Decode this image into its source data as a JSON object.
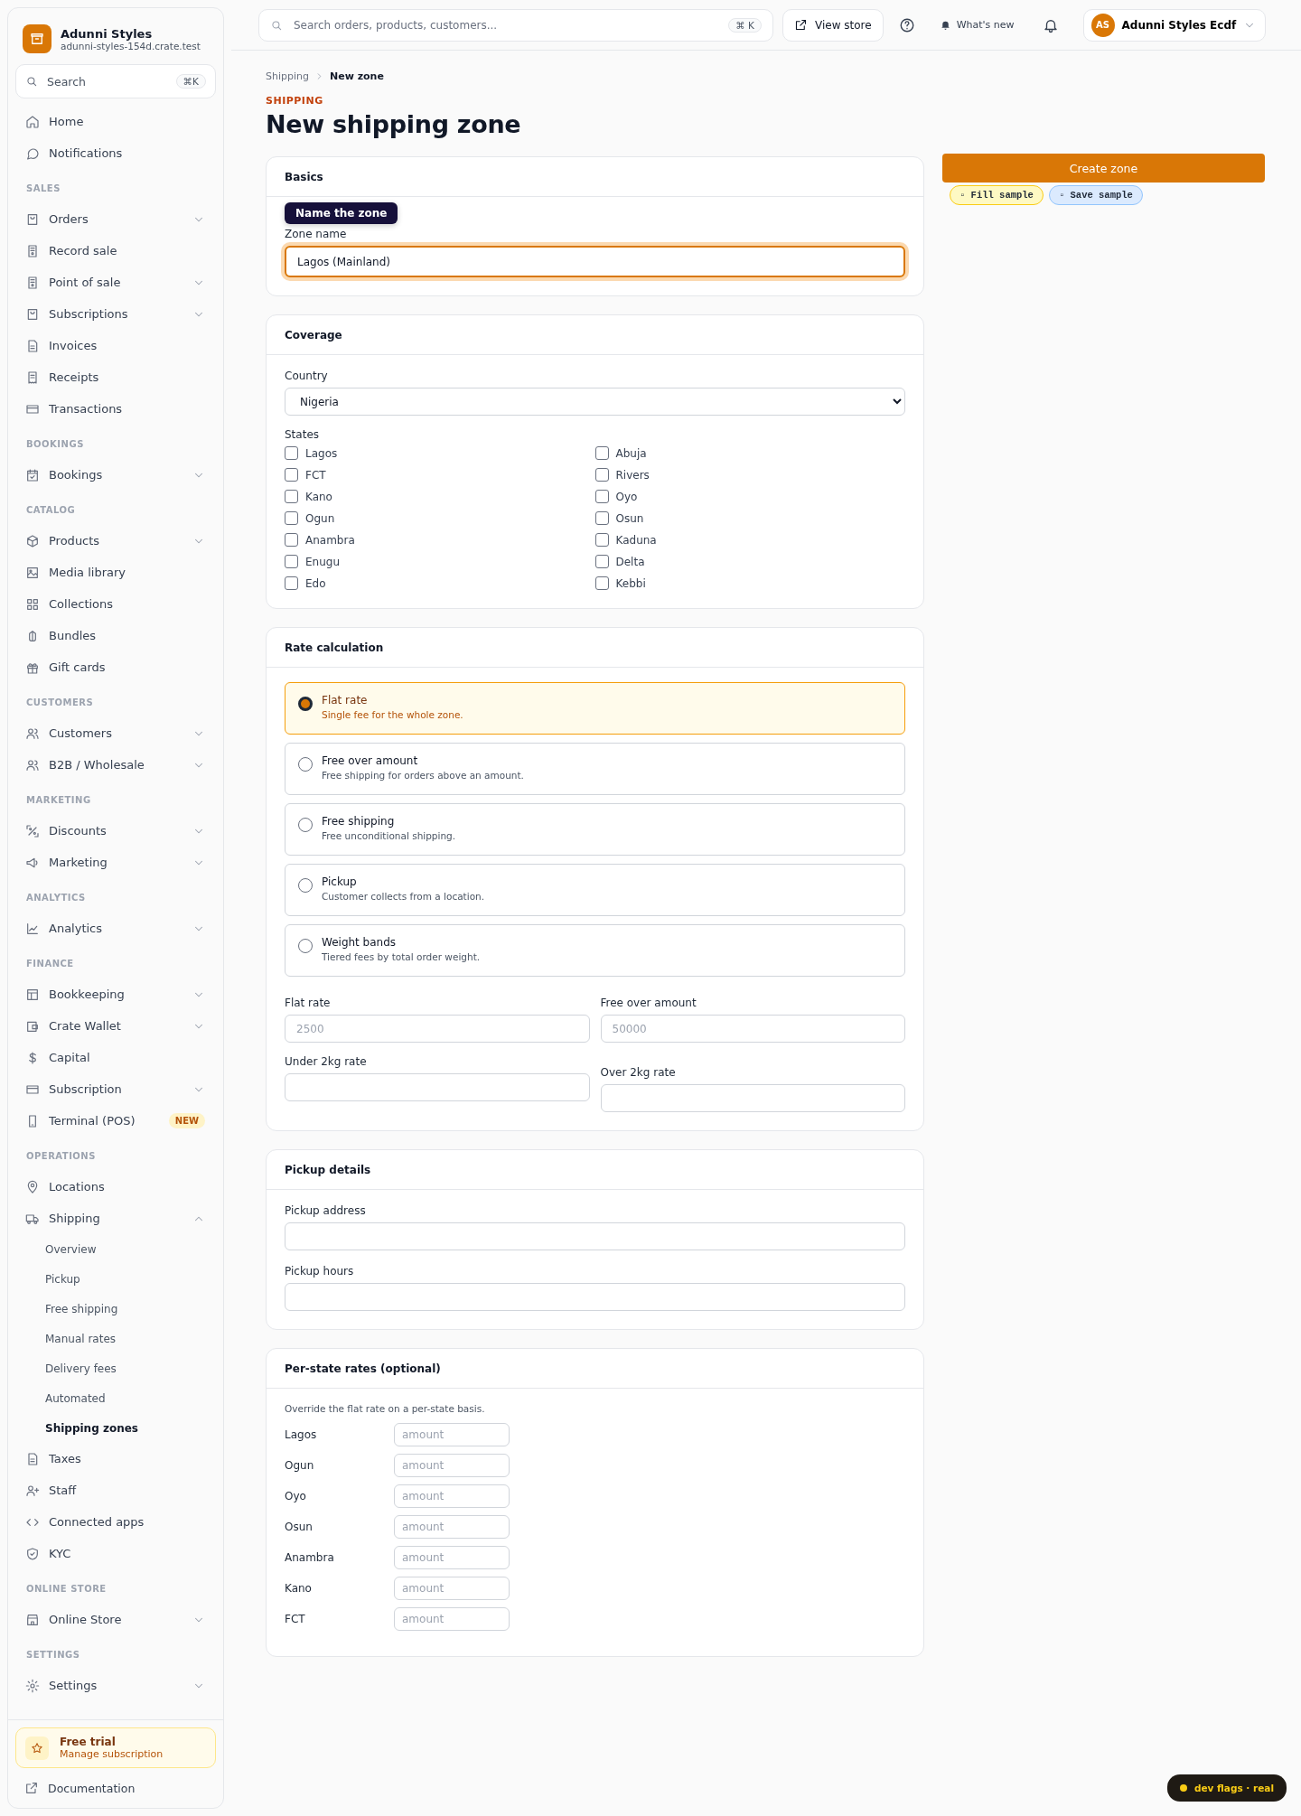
{
  "sidebar": {
    "brand": {
      "name": "Adunni Styles",
      "domain": "adunni-styles-154d.crate.test"
    },
    "search": {
      "placeholder": "Search",
      "shortcut": "⌘K"
    },
    "sections": [
      {
        "items": [
          {
            "label": "Home",
            "selected": false
          },
          {
            "label": "Notifications",
            "selected": false
          }
        ]
      },
      {
        "label": "SALES",
        "items": [
          {
            "label": "Orders",
            "selected": false,
            "expanded": false
          },
          {
            "label": "Record sale",
            "selected": false
          },
          {
            "label": "Point of sale",
            "selected": false,
            "expanded": false
          },
          {
            "label": "Subscriptions",
            "selected": false,
            "expanded": false
          },
          {
            "label": "Invoices",
            "selected": false
          },
          {
            "label": "Receipts",
            "selected": false
          },
          {
            "label": "Transactions",
            "selected": false
          }
        ]
      },
      {
        "label": "BOOKINGS",
        "items": [
          {
            "label": "Bookings",
            "selected": false,
            "expanded": false
          }
        ]
      },
      {
        "label": "CATALOG",
        "items": [
          {
            "label": "Products",
            "selected": false,
            "expanded": false
          },
          {
            "label": "Media library",
            "selected": false
          },
          {
            "label": "Collections",
            "selected": false
          },
          {
            "label": "Bundles",
            "selected": false
          },
          {
            "label": "Gift cards",
            "selected": false
          }
        ]
      },
      {
        "label": "CUSTOMERS",
        "items": [
          {
            "label": "Customers",
            "selected": false,
            "expanded": false
          },
          {
            "label": "B2B / Wholesale",
            "selected": false,
            "expanded": false
          }
        ]
      },
      {
        "label": "MARKETING",
        "items": [
          {
            "label": "Discounts",
            "selected": false,
            "expanded": false
          },
          {
            "label": "Marketing",
            "selected": false,
            "expanded": false
          }
        ]
      },
      {
        "label": "ANALYTICS",
        "items": [
          {
            "label": "Analytics",
            "selected": false,
            "expanded": false
          }
        ]
      },
      {
        "label": "FINANCE",
        "items": [
          {
            "label": "Bookkeeping",
            "selected": false,
            "expanded": false
          },
          {
            "label": "Crate Wallet",
            "selected": false,
            "expanded": false
          },
          {
            "label": "Capital",
            "selected": false
          },
          {
            "label": "Subscription",
            "selected": false,
            "expanded": false
          },
          {
            "label": "Terminal (POS)",
            "selected": false,
            "badge": "NEW"
          }
        ]
      },
      {
        "label": "OPERATIONS",
        "items": [
          {
            "label": "Locations",
            "selected": false
          },
          {
            "label": "Shipping",
            "selected": false,
            "expanded": true,
            "children": [
              {
                "label": "Overview",
                "selected": false
              },
              {
                "label": "Pickup",
                "selected": false
              },
              {
                "label": "Free shipping",
                "selected": false
              },
              {
                "label": "Manual rates",
                "selected": false
              },
              {
                "label": "Delivery fees",
                "selected": false
              },
              {
                "label": "Automated",
                "selected": false
              },
              {
                "label": "Shipping zones",
                "selected": true
              }
            ]
          },
          {
            "label": "Taxes",
            "selected": false
          },
          {
            "label": "Staff",
            "selected": false
          },
          {
            "label": "Connected apps",
            "selected": false
          },
          {
            "label": "KYC",
            "selected": false
          }
        ]
      },
      {
        "label": "ONLINE STORE",
        "items": [
          {
            "label": "Online Store",
            "selected": false,
            "expanded": false
          }
        ]
      },
      {
        "label": "SETTINGS",
        "items": [
          {
            "label": "Settings",
            "selected": false,
            "expanded": false
          }
        ]
      }
    ],
    "trial": {
      "title": "Free trial",
      "link": "Manage subscription"
    },
    "documentation": "Documentation"
  },
  "topbar": {
    "search": {
      "placeholder": "Search orders, products, customers...",
      "shortcut": "⌘ K"
    },
    "view_store": "View store",
    "whats_new": "What's new",
    "account": {
      "initials": "AS",
      "name": "Adunni Styles Ecdf"
    }
  },
  "breadcrumb": [
    "Shipping",
    "New zone"
  ],
  "eyebrow": "SHIPPING",
  "title": "New shipping zone",
  "actions": {
    "create": "Create zone",
    "dev_buttons": [
      {
        "label": "▫ Fill sample",
        "color": "#fef9c3"
      },
      {
        "label": "▫ Save sample",
        "color": "#dbeafe"
      }
    ]
  },
  "basics": {
    "title": "Basics",
    "field": {
      "label": "Zone name",
      "value": "Lagos (Mainland)",
      "focused": true
    },
    "tooltip": "Name the zone"
  },
  "coverage": {
    "title": "Coverage",
    "country_label": "Country",
    "country": "Nigeria",
    "states_label": "States",
    "states": [
      {
        "label": "Lagos",
        "checked": false
      },
      {
        "label": "Abuja",
        "checked": false
      },
      {
        "label": "FCT",
        "checked": false
      },
      {
        "label": "Rivers",
        "checked": false
      },
      {
        "label": "Kano",
        "checked": false
      },
      {
        "label": "Oyo",
        "checked": false
      },
      {
        "label": "Ogun",
        "checked": false
      },
      {
        "label": "Osun",
        "checked": false
      },
      {
        "label": "Anambra",
        "checked": false
      },
      {
        "label": "Kaduna",
        "checked": false
      },
      {
        "label": "Enugu",
        "checked": false
      },
      {
        "label": "Delta",
        "checked": false
      },
      {
        "label": "Edo",
        "checked": false
      },
      {
        "label": "Kebbi",
        "checked": false
      }
    ]
  },
  "rate_calculation": {
    "title": "Rate calculation",
    "options": [
      {
        "title": "Flat rate",
        "description": "Single fee for the whole zone.",
        "selected": true
      },
      {
        "title": "Free over amount",
        "description": "Free shipping for orders above an amount.",
        "selected": false
      },
      {
        "title": "Free shipping",
        "description": "Free unconditional shipping.",
        "selected": false
      },
      {
        "title": "Pickup",
        "description": "Customer collects from a location.",
        "selected": false
      },
      {
        "title": "Weight bands",
        "description": "Tiered fees by total order weight.",
        "selected": false
      }
    ],
    "fields": [
      {
        "label": "Flat rate",
        "placeholder": "2500"
      },
      {
        "label": "Free over amount",
        "placeholder": "50000"
      },
      {
        "label": "Under 2kg rate"
      },
      {
        "label": "Over 2kg rate"
      }
    ]
  },
  "pickup_details": {
    "title": "Pickup details",
    "fields": [
      {
        "label": "Pickup address"
      },
      {
        "label": "Pickup hours"
      }
    ]
  },
  "per_state_rates": {
    "title": "Per-state rates (optional)",
    "note": "Override the flat rate on a per-state basis.",
    "rows": [
      {
        "state": "Lagos",
        "placeholder": "amount"
      },
      {
        "state": "Ogun",
        "placeholder": "amount"
      },
      {
        "state": "Oyo",
        "placeholder": "amount"
      },
      {
        "state": "Osun",
        "placeholder": "amount"
      },
      {
        "state": "Anambra",
        "placeholder": "amount"
      },
      {
        "state": "Kano",
        "placeholder": "amount"
      },
      {
        "state": "FCT",
        "placeholder": "amount"
      }
    ]
  },
  "dev_flags": {
    "label": "dev flags · real",
    "color": "#facc15"
  }
}
